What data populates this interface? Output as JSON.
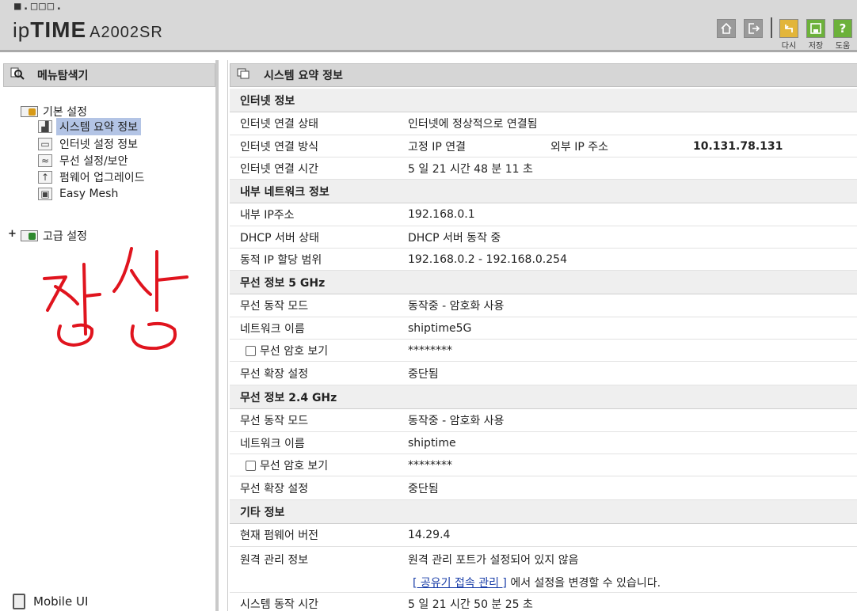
{
  "header": {
    "logo_dots": "■.□□□.",
    "logo_ip": "ip",
    "logo_time": "TIME",
    "model": "A2002SR",
    "btn_refresh": "다시",
    "btn_save": "저장",
    "btn_help": "도움",
    "help_glyph": "?"
  },
  "sidebar": {
    "title": "메뉴탐색기",
    "groups": [
      {
        "label": "기본 설정"
      },
      {
        "label": "고급 설정"
      }
    ],
    "items": [
      {
        "label": "시스템 요약 정보",
        "icon": "chart-icon"
      },
      {
        "label": "인터넷 설정 정보",
        "icon": "monitor-icon"
      },
      {
        "label": "무선 설정/보안",
        "icon": "wifi-icon"
      },
      {
        "label": "펌웨어 업그레이드",
        "icon": "upload-icon"
      },
      {
        "label": "Easy Mesh",
        "icon": "mesh-icon"
      }
    ],
    "expand_glyph": "+",
    "mobile_label": "Mobile UI"
  },
  "handwriting": "정상",
  "main": {
    "title": "시스템 요약 정보",
    "sections": {
      "internet": "인터넷 정보",
      "lan": "내부 네트워크 정보",
      "wifi5": "무선 정보 5 GHz",
      "wifi24": "무선 정보 2.4 GHz",
      "etc": "기타 정보"
    },
    "rows": {
      "inet_status_k": "인터넷 연결 상태",
      "inet_status_v": "인터넷에 정상적으로 연결됨",
      "inet_mode_k": "인터넷 연결 방식",
      "inet_mode_v": "고정 IP 연결",
      "ext_ip_k": "외부 IP 주소",
      "ext_ip_v": "10.131.78.131",
      "inet_time_k": "인터넷 연결 시간",
      "inet_time_v": "5 일 21 시간 48 분 11 초",
      "lan_ip_k": "내부 IP주소",
      "lan_ip_v": "192.168.0.1",
      "dhcp_k": "DHCP 서버 상태",
      "dhcp_v": "DHCP 서버 동작 중",
      "dyn_k": "동적 IP 할당 범위",
      "dyn_v": "192.168.0.2 -  192.168.0.254",
      "w5_mode_k": "무선 동작 모드",
      "w5_mode_v": "동작중 - 암호화 사용",
      "w5_name_k": "네트워크 이름",
      "w5_name_v": "shiptime5G",
      "w5_pw_k": "무선 암호 보기",
      "w5_pw_v": "********",
      "w5_ext_k": "무선 확장 설정",
      "w5_ext_v": "중단됨",
      "w24_mode_k": "무선 동작 모드",
      "w24_mode_v": "동작중 - 암호화 사용",
      "w24_name_k": "네트워크 이름",
      "w24_name_v": "shiptime",
      "w24_pw_k": "무선 암호 보기",
      "w24_pw_v": "********",
      "w24_ext_k": "무선 확장 설정",
      "w24_ext_v": "중단됨",
      "fw_k": "현재 펌웨어 버전",
      "fw_v": "14.29.4",
      "remote_k": "원격 관리 정보",
      "remote_v": "원격 관리 포트가 설정되어 있지 않음",
      "remote_link": "[ 공유기 접속 관리 ]",
      "remote_link_suffix": " 에서 설정을 변경할 수 있습니다.",
      "uptime_k": "시스템 동작 시간",
      "uptime_v": "5 일 21 시간 50 분 25 초"
    }
  }
}
